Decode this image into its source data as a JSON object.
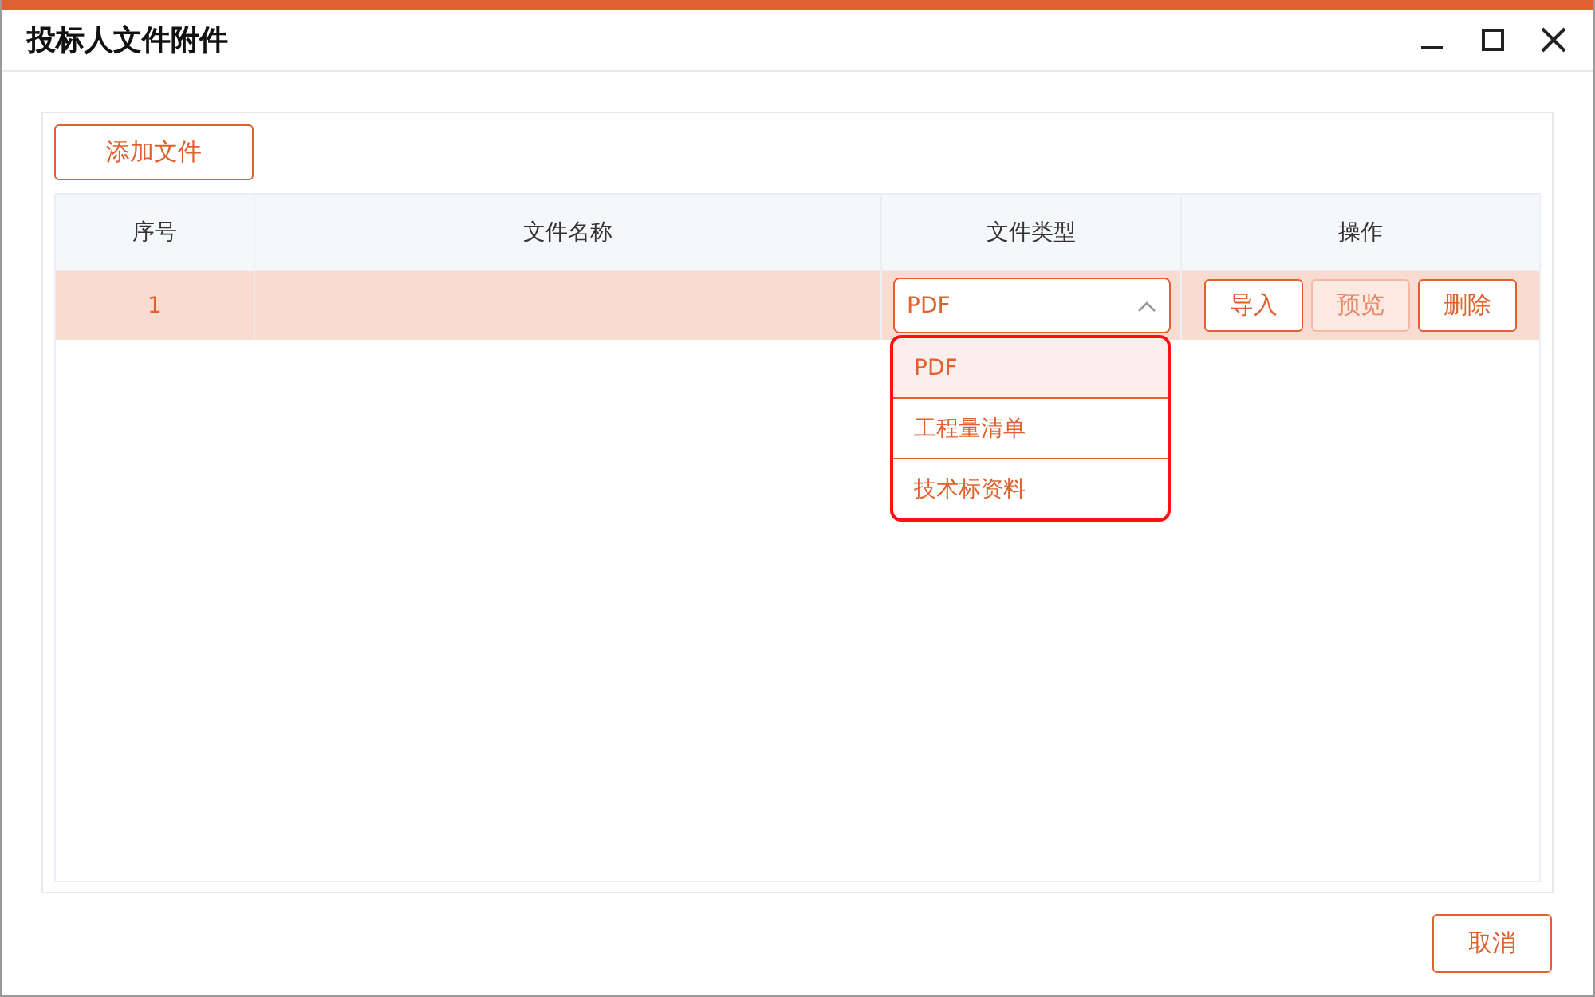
{
  "window": {
    "title": "投标人文件附件"
  },
  "toolbar": {
    "add_button": "添加文件"
  },
  "table": {
    "columns": [
      "序号",
      "文件名称",
      "文件类型",
      "操作"
    ],
    "rows": [
      {
        "index": "1",
        "selected": true,
        "type_select": {
          "value": "PDF",
          "expanded": true,
          "options": [
            {
              "label": "PDF",
              "selected": true
            },
            {
              "label": "工程量清单",
              "selected": false
            },
            {
              "label": "技术标资料",
              "selected": false
            }
          ]
        },
        "actions": [
          {
            "label": "导入",
            "disabled": false
          },
          {
            "label": "预览",
            "disabled": true
          },
          {
            "label": "删除",
            "disabled": false
          }
        ]
      }
    ]
  },
  "footer": {
    "cancel_button": "取消"
  }
}
